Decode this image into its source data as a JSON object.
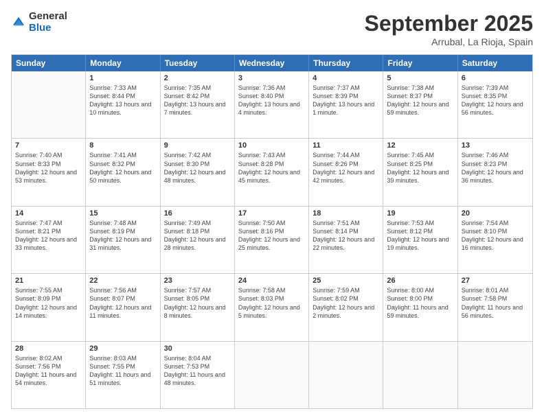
{
  "logo": {
    "general": "General",
    "blue": "Blue"
  },
  "title": "September 2025",
  "location": "Arrubal, La Rioja, Spain",
  "days": [
    "Sunday",
    "Monday",
    "Tuesday",
    "Wednesday",
    "Thursday",
    "Friday",
    "Saturday"
  ],
  "weeks": [
    [
      {
        "day": "",
        "sunrise": "",
        "sunset": "",
        "daylight": ""
      },
      {
        "day": "1",
        "sunrise": "Sunrise: 7:33 AM",
        "sunset": "Sunset: 8:44 PM",
        "daylight": "Daylight: 13 hours and 10 minutes."
      },
      {
        "day": "2",
        "sunrise": "Sunrise: 7:35 AM",
        "sunset": "Sunset: 8:42 PM",
        "daylight": "Daylight: 13 hours and 7 minutes."
      },
      {
        "day": "3",
        "sunrise": "Sunrise: 7:36 AM",
        "sunset": "Sunset: 8:40 PM",
        "daylight": "Daylight: 13 hours and 4 minutes."
      },
      {
        "day": "4",
        "sunrise": "Sunrise: 7:37 AM",
        "sunset": "Sunset: 8:39 PM",
        "daylight": "Daylight: 13 hours and 1 minute."
      },
      {
        "day": "5",
        "sunrise": "Sunrise: 7:38 AM",
        "sunset": "Sunset: 8:37 PM",
        "daylight": "Daylight: 12 hours and 59 minutes."
      },
      {
        "day": "6",
        "sunrise": "Sunrise: 7:39 AM",
        "sunset": "Sunset: 8:35 PM",
        "daylight": "Daylight: 12 hours and 56 minutes."
      }
    ],
    [
      {
        "day": "7",
        "sunrise": "Sunrise: 7:40 AM",
        "sunset": "Sunset: 8:33 PM",
        "daylight": "Daylight: 12 hours and 53 minutes."
      },
      {
        "day": "8",
        "sunrise": "Sunrise: 7:41 AM",
        "sunset": "Sunset: 8:32 PM",
        "daylight": "Daylight: 12 hours and 50 minutes."
      },
      {
        "day": "9",
        "sunrise": "Sunrise: 7:42 AM",
        "sunset": "Sunset: 8:30 PM",
        "daylight": "Daylight: 12 hours and 48 minutes."
      },
      {
        "day": "10",
        "sunrise": "Sunrise: 7:43 AM",
        "sunset": "Sunset: 8:28 PM",
        "daylight": "Daylight: 12 hours and 45 minutes."
      },
      {
        "day": "11",
        "sunrise": "Sunrise: 7:44 AM",
        "sunset": "Sunset: 8:26 PM",
        "daylight": "Daylight: 12 hours and 42 minutes."
      },
      {
        "day": "12",
        "sunrise": "Sunrise: 7:45 AM",
        "sunset": "Sunset: 8:25 PM",
        "daylight": "Daylight: 12 hours and 39 minutes."
      },
      {
        "day": "13",
        "sunrise": "Sunrise: 7:46 AM",
        "sunset": "Sunset: 8:23 PM",
        "daylight": "Daylight: 12 hours and 36 minutes."
      }
    ],
    [
      {
        "day": "14",
        "sunrise": "Sunrise: 7:47 AM",
        "sunset": "Sunset: 8:21 PM",
        "daylight": "Daylight: 12 hours and 33 minutes."
      },
      {
        "day": "15",
        "sunrise": "Sunrise: 7:48 AM",
        "sunset": "Sunset: 8:19 PM",
        "daylight": "Daylight: 12 hours and 31 minutes."
      },
      {
        "day": "16",
        "sunrise": "Sunrise: 7:49 AM",
        "sunset": "Sunset: 8:18 PM",
        "daylight": "Daylight: 12 hours and 28 minutes."
      },
      {
        "day": "17",
        "sunrise": "Sunrise: 7:50 AM",
        "sunset": "Sunset: 8:16 PM",
        "daylight": "Daylight: 12 hours and 25 minutes."
      },
      {
        "day": "18",
        "sunrise": "Sunrise: 7:51 AM",
        "sunset": "Sunset: 8:14 PM",
        "daylight": "Daylight: 12 hours and 22 minutes."
      },
      {
        "day": "19",
        "sunrise": "Sunrise: 7:53 AM",
        "sunset": "Sunset: 8:12 PM",
        "daylight": "Daylight: 12 hours and 19 minutes."
      },
      {
        "day": "20",
        "sunrise": "Sunrise: 7:54 AM",
        "sunset": "Sunset: 8:10 PM",
        "daylight": "Daylight: 12 hours and 16 minutes."
      }
    ],
    [
      {
        "day": "21",
        "sunrise": "Sunrise: 7:55 AM",
        "sunset": "Sunset: 8:09 PM",
        "daylight": "Daylight: 12 hours and 14 minutes."
      },
      {
        "day": "22",
        "sunrise": "Sunrise: 7:56 AM",
        "sunset": "Sunset: 8:07 PM",
        "daylight": "Daylight: 12 hours and 11 minutes."
      },
      {
        "day": "23",
        "sunrise": "Sunrise: 7:57 AM",
        "sunset": "Sunset: 8:05 PM",
        "daylight": "Daylight: 12 hours and 8 minutes."
      },
      {
        "day": "24",
        "sunrise": "Sunrise: 7:58 AM",
        "sunset": "Sunset: 8:03 PM",
        "daylight": "Daylight: 12 hours and 5 minutes."
      },
      {
        "day": "25",
        "sunrise": "Sunrise: 7:59 AM",
        "sunset": "Sunset: 8:02 PM",
        "daylight": "Daylight: 12 hours and 2 minutes."
      },
      {
        "day": "26",
        "sunrise": "Sunrise: 8:00 AM",
        "sunset": "Sunset: 8:00 PM",
        "daylight": "Daylight: 11 hours and 59 minutes."
      },
      {
        "day": "27",
        "sunrise": "Sunrise: 8:01 AM",
        "sunset": "Sunset: 7:58 PM",
        "daylight": "Daylight: 11 hours and 56 minutes."
      }
    ],
    [
      {
        "day": "28",
        "sunrise": "Sunrise: 8:02 AM",
        "sunset": "Sunset: 7:56 PM",
        "daylight": "Daylight: 11 hours and 54 minutes."
      },
      {
        "day": "29",
        "sunrise": "Sunrise: 8:03 AM",
        "sunset": "Sunset: 7:55 PM",
        "daylight": "Daylight: 11 hours and 51 minutes."
      },
      {
        "day": "30",
        "sunrise": "Sunrise: 8:04 AM",
        "sunset": "Sunset: 7:53 PM",
        "daylight": "Daylight: 11 hours and 48 minutes."
      },
      {
        "day": "",
        "sunrise": "",
        "sunset": "",
        "daylight": ""
      },
      {
        "day": "",
        "sunrise": "",
        "sunset": "",
        "daylight": ""
      },
      {
        "day": "",
        "sunrise": "",
        "sunset": "",
        "daylight": ""
      },
      {
        "day": "",
        "sunrise": "",
        "sunset": "",
        "daylight": ""
      }
    ]
  ]
}
